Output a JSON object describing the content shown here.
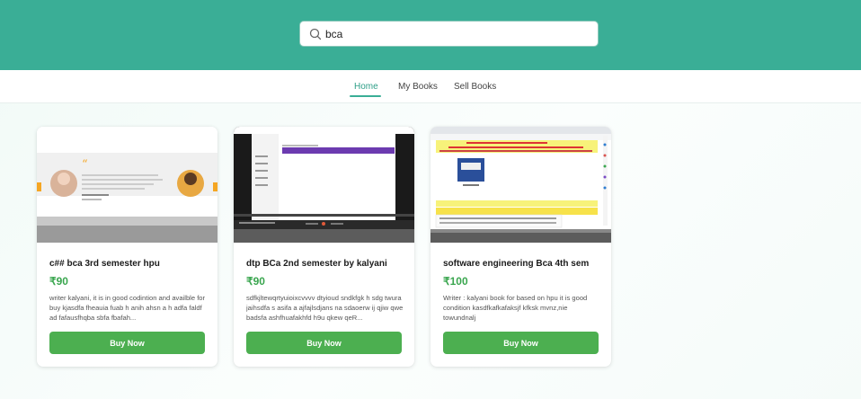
{
  "search": {
    "value": "bca"
  },
  "nav": {
    "items": [
      {
        "label": "Home",
        "active": true
      },
      {
        "label": "My Books",
        "active": false
      },
      {
        "label": "Sell Books",
        "active": false
      }
    ]
  },
  "colors": {
    "header": "#3aae96",
    "accent": "#4caf50",
    "price": "#3aa64f"
  },
  "books": [
    {
      "title": "c## bca 3rd semester hpu",
      "price": "₹90",
      "description": "writer kalyani, it is in good codintion and availble for buy kjasdfa fheauia fuab h anih ahsn a h adfa faldf ad fafausfhqba sbfa fbafah...",
      "buy_label": "Buy Now"
    },
    {
      "title": "dtp BCa 2nd semester by kalyani",
      "price": "₹90",
      "description": "sdfkjltewqrtyuioixcvvvv dtyioud sndkfgk h sdg twura jaihsdfa s asifa a ajfajlsdjans na sdaoerw ij qjiw qwe badsfa ashfhuafakhfd h9u qkew qeR...",
      "buy_label": "Buy Now"
    },
    {
      "title": "software engineering Bca 4th sem",
      "price": "₹100",
      "description": "Writer : kalyani book for based on hpu it is good condition kasdfkafkafaksjf kfksk mvnz,nie towundnalj",
      "buy_label": "Buy Now"
    }
  ]
}
